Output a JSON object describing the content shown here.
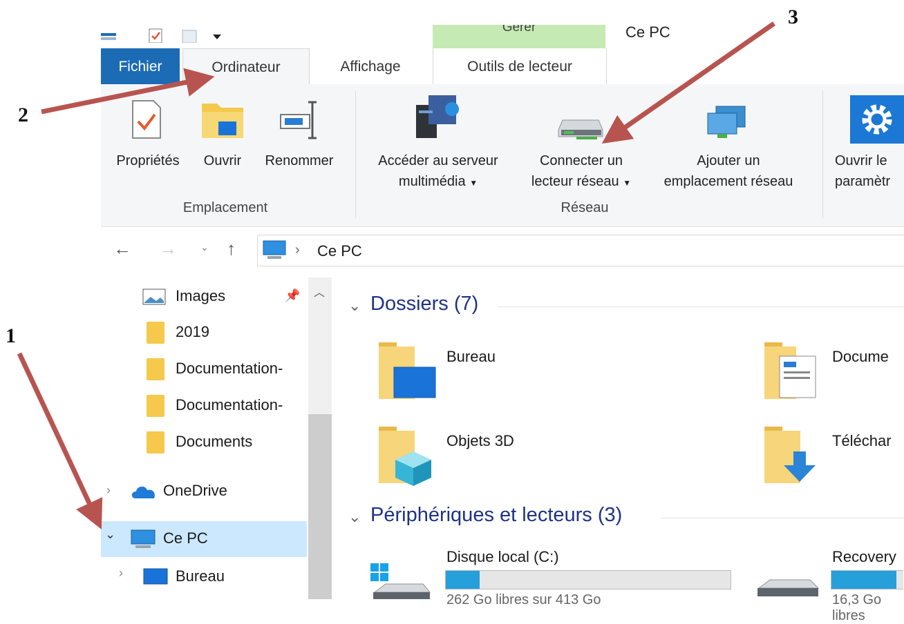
{
  "title_bar": {
    "manage_tab": "Gérer",
    "window_title": "Ce PC"
  },
  "tabs": {
    "file": "Fichier",
    "computer": "Ordinateur",
    "view": "Affichage",
    "drive_tools": "Outils de lecteur"
  },
  "ribbon": {
    "properties": "Propriétés",
    "open": "Ouvrir",
    "rename": "Renommer",
    "media_line1": "Accéder au serveur",
    "media_line2": "multimédia",
    "map_line1": "Connecter un",
    "map_line2": "lecteur réseau",
    "addloc_line1": "Ajouter un",
    "addloc_line2": "emplacement réseau",
    "settings_line1": "Ouvrir le",
    "settings_line2": "paramètr",
    "group_location": "Emplacement",
    "group_network": "Réseau"
  },
  "address": {
    "path": "Ce PC"
  },
  "nav": {
    "images": "Images",
    "folder_2019": "2019",
    "doc1": "Documentation-",
    "doc2": "Documentation-",
    "documents": "Documents",
    "onedrive": "OneDrive",
    "this_pc": "Ce PC",
    "desktop": "Bureau"
  },
  "content": {
    "folders_section": "Dossiers (7)",
    "desktop": "Bureau",
    "documents": "Docume",
    "objects3d": "Objets 3D",
    "downloads": "Téléchar",
    "devices_section": "Périphériques et lecteurs (3)",
    "drive_c": "Disque local (C:)",
    "drive_c_free": "262 Go libres sur 413 Go",
    "drive_c_used_fraction": 0.12,
    "recovery": "Recovery",
    "recovery_free": "16,3 Go libres",
    "recovery_used_fraction": 0.9
  },
  "annotations": {
    "a1": "1",
    "a2": "2",
    "a3": "3"
  },
  "colors": {
    "file_tab": "#1b6bb5",
    "manage_tab": "#c5eab3",
    "selection": "#cce8ff",
    "section_title": "#1e3287",
    "drive_fill": "#26a0da",
    "arrow": "#b85450"
  }
}
